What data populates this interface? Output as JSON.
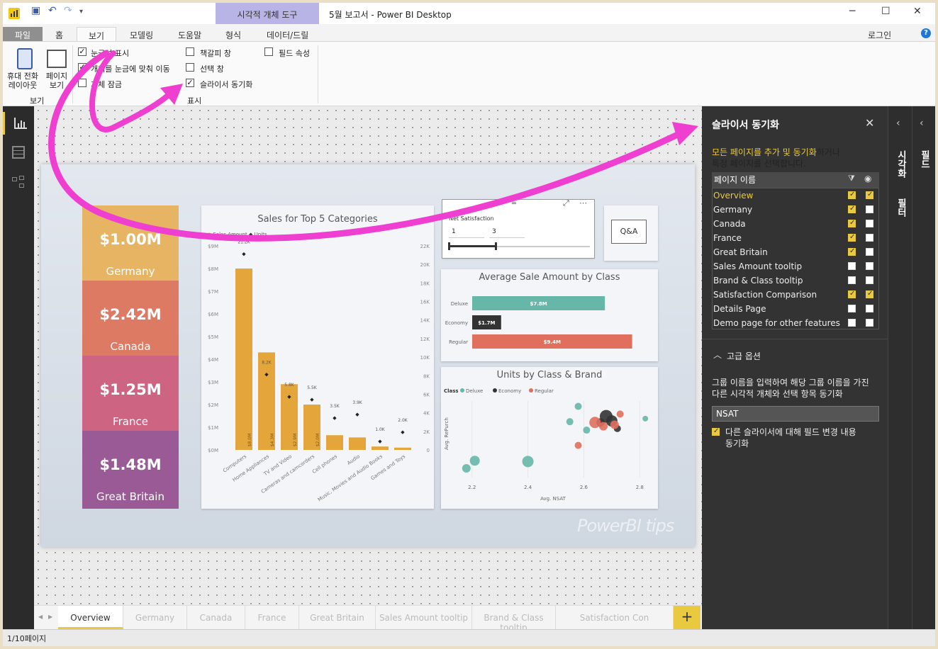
{
  "window": {
    "title": "5월 보고서 - Power BI Desktop",
    "contextual_tab": "시각적 개체 도구",
    "signin": "로그인",
    "help": "?"
  },
  "colors": {
    "accent": "#e8c93f",
    "arrow": "#ee3fd0",
    "card1": "#e7b463",
    "card2": "#dd7a63",
    "card3": "#cc6482",
    "card4": "#9a5a96",
    "bar": "#e4a63a",
    "teal": "#67b7a9",
    "coral": "#e06f5d",
    "dark": "#333333"
  },
  "icons": {
    "save": "save-icon",
    "undo": "undo-icon",
    "redo": "redo-icon",
    "report": "report-view-icon",
    "data": "data-view-icon",
    "model": "model-view-icon"
  },
  "tabs": [
    "파일",
    "홈",
    "보기",
    "모델링",
    "도움말",
    "형식",
    "데이터/드릴"
  ],
  "ribbon": {
    "btn_mobile": "휴대 전화\n레이아웃",
    "btn_page": "페이지\n보기",
    "group_view": "보기",
    "cb_gridlines": "눈금선 표시",
    "cb_snap": "개체를 눈금에 맞춰 이동",
    "cb_lock": "개체 잠금",
    "cb_bookmarks": "책갈피 창",
    "cb_selection": "선택 창",
    "cb_sync": "슬라이서 동기화",
    "cb_fields": "필드 속성",
    "group_show": "표시"
  },
  "cards": [
    {
      "value": "$1.00M",
      "name": "Germany"
    },
    {
      "value": "$2.42M",
      "name": "Canada"
    },
    {
      "value": "$1.25M",
      "name": "France"
    },
    {
      "value": "$1.48M",
      "name": "Great Britain"
    }
  ],
  "sales_chart": {
    "title": "Sales for Top 5 Categories",
    "legend_a": "Sales Amount",
    "legend_b": "Units"
  },
  "chart_data": [
    {
      "type": "bar",
      "title": "Sales for Top 5 Categories",
      "categories": [
        "Computers",
        "Home Appliances",
        "TV and Video",
        "Cameras and camcorders",
        "Cell phones",
        "Audio",
        "Music, Movies and Audio Books",
        "Games and Toys"
      ],
      "series": [
        {
          "name": "Sales Amount",
          "values": [
            8.0,
            4.3,
            2.9,
            2.0,
            0.65,
            0.55,
            0.15,
            0.1
          ]
        },
        {
          "name": "Units",
          "values": [
            21.2,
            8.2,
            5.8,
            5.5,
            3.5,
            3.9,
            1.0,
            2.0
          ],
          "point_labels": [
            "21.2K",
            "8.2K",
            "5.8K",
            "5.5K",
            "3.5K",
            "3.9K",
            "1.0K",
            "2.0K"
          ]
        }
      ],
      "bar_labels": [
        "$8.0M",
        "$4.3M",
        "$2.9M",
        "$2.0M",
        "",
        "",
        "",
        ""
      ],
      "yticks": [
        "$0M",
        "$1M",
        "$2M",
        "$3M",
        "$4M",
        "$5M",
        "$6M",
        "$7M",
        "$8M",
        "$9M"
      ],
      "y2ticks": [
        "0",
        "2K",
        "4K",
        "6K",
        "8K",
        "10K",
        "12K",
        "14K",
        "16K",
        "18K",
        "20K",
        "22K"
      ],
      "ylim": [
        0,
        9
      ]
    },
    {
      "type": "bar",
      "title": "Average Sale Amount by Class",
      "categories": [
        "Deluxe",
        "Economy",
        "Regular"
      ],
      "values": [
        7.8,
        1.7,
        9.4
      ],
      "labels": [
        "$7.8M",
        "$1.7M",
        "$9.4M"
      ],
      "xlim": [
        0,
        10
      ]
    },
    {
      "type": "scatter",
      "title": "Units by Class & Brand",
      "legend_title": "Class",
      "series_names": [
        "Deluxe",
        "Economy",
        "Regular"
      ],
      "xlabel": "Avg. NSAT",
      "ylabel": "Avg. RePurch",
      "xticks": [
        "2.2",
        "2.4",
        "2.6",
        "2.8"
      ],
      "xlim": [
        2.15,
        2.85
      ],
      "ylim": [
        0,
        1
      ],
      "points": [
        {
          "s": 0,
          "x": 2.18,
          "y": 0.12,
          "r": 6
        },
        {
          "s": 0,
          "x": 2.21,
          "y": 0.22,
          "r": 7
        },
        {
          "s": 0,
          "x": 2.4,
          "y": 0.21,
          "r": 8
        },
        {
          "s": 0,
          "x": 2.55,
          "y": 0.73,
          "r": 5
        },
        {
          "s": 0,
          "x": 2.58,
          "y": 0.93,
          "r": 5
        },
        {
          "s": 0,
          "x": 2.82,
          "y": 0.77,
          "r": 4
        },
        {
          "s": 0,
          "x": 2.61,
          "y": 0.62,
          "r": 5
        },
        {
          "s": 1,
          "x": 2.68,
          "y": 0.8,
          "r": 9
        },
        {
          "s": 1,
          "x": 2.7,
          "y": 0.74,
          "r": 8
        },
        {
          "s": 1,
          "x": 2.66,
          "y": 0.72,
          "r": 6
        },
        {
          "s": 1,
          "x": 2.72,
          "y": 0.64,
          "r": 5
        },
        {
          "s": 2,
          "x": 2.64,
          "y": 0.72,
          "r": 8
        },
        {
          "s": 2,
          "x": 2.67,
          "y": 0.67,
          "r": 6
        },
        {
          "s": 2,
          "x": 2.71,
          "y": 0.69,
          "r": 6
        },
        {
          "s": 2,
          "x": 2.58,
          "y": 0.42,
          "r": 5
        },
        {
          "s": 2,
          "x": 2.73,
          "y": 0.83,
          "r": 5
        }
      ]
    }
  ],
  "slicer": {
    "title": "Net Satisfaction",
    "min": "1",
    "max": "3"
  },
  "qna": "Q&A",
  "avg_title": "Average Sale Amount by Class",
  "units_title": "Units by Class & Brand",
  "watermark": "PowerBI tips",
  "sync": {
    "title": "슬라이서 동기화",
    "desc_link": "모든 페이지를 추가 및 동기화",
    "desc_rest": "하거나\n특정 페이지를 선택합니다.",
    "col_page": "페이지 이름",
    "pages": [
      {
        "name": "Overview",
        "sync": true,
        "visible": true
      },
      {
        "name": "Germany",
        "sync": true,
        "visible": false
      },
      {
        "name": "Canada",
        "sync": true,
        "visible": false
      },
      {
        "name": "France",
        "sync": true,
        "visible": false
      },
      {
        "name": "Great Britain",
        "sync": true,
        "visible": false
      },
      {
        "name": "Sales Amount tooltip",
        "sync": false,
        "visible": false
      },
      {
        "name": "Brand & Class tooltip",
        "sync": false,
        "visible": false
      },
      {
        "name": "Satisfaction Comparison",
        "sync": true,
        "visible": true
      },
      {
        "name": "Details Page",
        "sync": false,
        "visible": false
      },
      {
        "name": "Demo page for other features",
        "sync": false,
        "visible": false
      }
    ],
    "advanced": "고급 옵션",
    "adv_desc": "그룹 이름을 입력하여 해당 그룹 이름을 가진\n다른 시각적 개체와 선택 항목 동기화",
    "group_value": "NSAT",
    "adv_cb": "다른 슬라이서에 대해 필드 변경 내용\n동기화"
  },
  "side": {
    "viz": "시각화",
    "filters": "필터",
    "fields": "필드"
  },
  "pagetabs": [
    "Overview",
    "Germany",
    "Canada",
    "France",
    "Great Britain",
    "Sales Amount tooltip",
    "Brand & Class tooltip",
    "Satisfaction Con"
  ],
  "status": "1/10페이지"
}
